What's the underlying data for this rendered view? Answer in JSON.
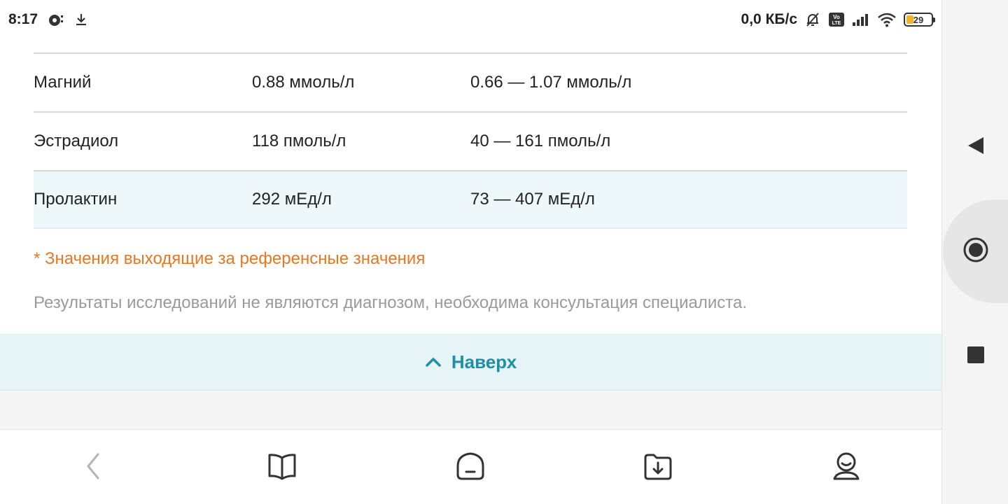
{
  "status_bar": {
    "time": "8:17",
    "network_speed": "0,0 КБ/с",
    "battery_level": "29",
    "icons": [
      "notification-app-icon",
      "download-icon",
      "bell-off-icon",
      "volte-icon",
      "signal-icon",
      "wifi-icon",
      "battery-icon"
    ]
  },
  "results": {
    "rows": [
      {
        "name": "Магний",
        "value": "0.88 ммоль/л",
        "reference": "0.66 — 1.07 ммоль/л"
      },
      {
        "name": "Эстрадиол",
        "value": "118 пмоль/л",
        "reference": "40 — 161 пмоль/л"
      },
      {
        "name": "Пролактин",
        "value": "292 мЕд/л",
        "reference": "73 — 407 мЕд/л"
      }
    ]
  },
  "notes": {
    "warning": "* Значения выходящие за референсные значения",
    "disclaimer": "Результаты исследований не являются диагнозом, необходима консультация специалиста."
  },
  "to_top": {
    "label": "Наверх"
  },
  "bottom_nav": {
    "items": [
      "back-icon",
      "book-icon",
      "home-icon",
      "downloads-folder-icon",
      "profile-icon"
    ]
  },
  "system_nav": {
    "items": [
      "back-triangle-icon",
      "home-circle-icon",
      "recents-square-icon"
    ]
  },
  "colors": {
    "warning": "#e87722",
    "accent": "#1f8fa5",
    "highlight_row": "#eef7fa",
    "to_top_bg": "#e6f3f7",
    "muted_text": "#9a9a9a"
  }
}
